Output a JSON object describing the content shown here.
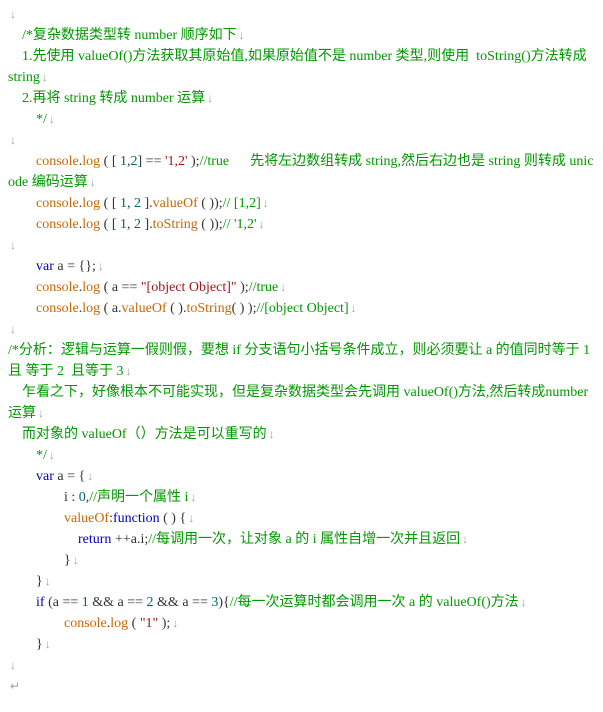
{
  "lines": [
    {
      "segments": [
        {
          "cls": "arrow",
          "t": "↓"
        }
      ]
    },
    {
      "indent": 1,
      "segments": [
        {
          "cls": "comment",
          "t": "/*复杂数据类型转 number 顺序如下"
        },
        {
          "cls": "arrow",
          "t": "↓"
        }
      ]
    },
    {
      "indent": 1,
      "segments": [
        {
          "cls": "comment",
          "t": "1.先使用 valueOf()方法获取其原始值,如果原始值不是 number 类型,则使用  toString()方法转成 string"
        },
        {
          "cls": "arrow",
          "t": "↓"
        }
      ]
    },
    {
      "indent": 1,
      "segments": [
        {
          "cls": "comment",
          "t": "2.再将 string 转成 number 运算"
        },
        {
          "cls": "arrow",
          "t": "↓"
        }
      ]
    },
    {
      "indent": 2,
      "segments": [
        {
          "cls": "comment",
          "t": "*/"
        },
        {
          "cls": "arrow",
          "t": "↓"
        }
      ]
    },
    {
      "segments": [
        {
          "cls": "arrow",
          "t": "↓"
        }
      ]
    },
    {
      "indent": 2,
      "segments": [
        {
          "cls": "method",
          "t": "console"
        },
        {
          "cls": "op",
          "t": "."
        },
        {
          "cls": "method",
          "t": "log"
        },
        {
          "cls": "op",
          "t": " ("
        },
        {
          "cls": "op",
          "t": " [ "
        },
        {
          "cls": "number",
          "t": "1"
        },
        {
          "cls": "op",
          "t": ","
        },
        {
          "cls": "number",
          "t": "2"
        },
        {
          "cls": "op",
          "t": "] "
        },
        {
          "cls": "op",
          "t": "=="
        },
        {
          "cls": "string",
          "t": " '1,2'"
        },
        {
          "cls": "op",
          "t": " );"
        },
        {
          "cls": "comment",
          "t": "//true      先将左边数组转成 string,然后右边也是 string 则转成 unicode 编码运算"
        },
        {
          "cls": "arrow",
          "t": "↓"
        }
      ]
    },
    {
      "indent": 2,
      "segments": [
        {
          "cls": "method",
          "t": "console"
        },
        {
          "cls": "op",
          "t": "."
        },
        {
          "cls": "method",
          "t": "log"
        },
        {
          "cls": "op",
          "t": " ("
        },
        {
          "cls": "op",
          "t": " [ "
        },
        {
          "cls": "number",
          "t": "1"
        },
        {
          "cls": "op",
          "t": ", "
        },
        {
          "cls": "number",
          "t": "2"
        },
        {
          "cls": "op",
          "t": " ]."
        },
        {
          "cls": "method",
          "t": "valueOf"
        },
        {
          "cls": "op",
          "t": " ( ));"
        },
        {
          "cls": "comment",
          "t": "// [1,2]"
        },
        {
          "cls": "arrow",
          "t": "↓"
        }
      ]
    },
    {
      "indent": 2,
      "segments": [
        {
          "cls": "method",
          "t": "console"
        },
        {
          "cls": "op",
          "t": "."
        },
        {
          "cls": "method",
          "t": "log"
        },
        {
          "cls": "op",
          "t": " ("
        },
        {
          "cls": "op",
          "t": " [ "
        },
        {
          "cls": "number",
          "t": "1"
        },
        {
          "cls": "op",
          "t": ", "
        },
        {
          "cls": "number",
          "t": "2"
        },
        {
          "cls": "op",
          "t": " ]."
        },
        {
          "cls": "method",
          "t": "toString"
        },
        {
          "cls": "op",
          "t": " ( ));"
        },
        {
          "cls": "comment",
          "t": "// '1,2'"
        },
        {
          "cls": "arrow",
          "t": "↓"
        }
      ]
    },
    {
      "segments": [
        {
          "cls": "arrow",
          "t": "↓"
        }
      ]
    },
    {
      "indent": 2,
      "segments": [
        {
          "cls": "keyword",
          "t": "var "
        },
        {
          "cls": "op",
          "t": "a "
        },
        {
          "cls": "op",
          "t": "= "
        },
        {
          "cls": "op",
          "t": "{};"
        },
        {
          "cls": "arrow",
          "t": "↓"
        }
      ]
    },
    {
      "indent": 2,
      "segments": [
        {
          "cls": "method",
          "t": "console"
        },
        {
          "cls": "op",
          "t": "."
        },
        {
          "cls": "method",
          "t": "log"
        },
        {
          "cls": "op",
          "t": " ("
        },
        {
          "cls": "op",
          "t": " a "
        },
        {
          "cls": "op",
          "t": "=="
        },
        {
          "cls": "string",
          "t": " \"[object Object]\""
        },
        {
          "cls": "op",
          "t": " );"
        },
        {
          "cls": "comment",
          "t": "//true"
        },
        {
          "cls": "arrow",
          "t": "↓"
        }
      ]
    },
    {
      "indent": 2,
      "segments": [
        {
          "cls": "method",
          "t": "console"
        },
        {
          "cls": "op",
          "t": "."
        },
        {
          "cls": "method",
          "t": "log"
        },
        {
          "cls": "op",
          "t": " ("
        },
        {
          "cls": "op",
          "t": " a."
        },
        {
          "cls": "method",
          "t": "valueOf"
        },
        {
          "cls": "op",
          "t": " ( )."
        },
        {
          "cls": "method",
          "t": "toString"
        },
        {
          "cls": "op",
          "t": "( ) );"
        },
        {
          "cls": "comment",
          "t": "//[object Object]"
        },
        {
          "cls": "arrow",
          "t": "↓"
        }
      ]
    },
    {
      "segments": [
        {
          "cls": "arrow",
          "t": "↓"
        }
      ]
    },
    {
      "segments": [
        {
          "cls": "comment",
          "t": "/*分析：逻辑与运算一假则假，要想 if 分支语句小括号条件成立，则必须要让 a 的值同时等于 1 且 等于 2  且等于 3"
        },
        {
          "cls": "arrow",
          "t": "↓"
        }
      ]
    },
    {
      "indent": 1,
      "segments": [
        {
          "cls": "comment",
          "t": "乍看之下，好像根本不可能实现，但是复杂数据类型会先调用 valueOf()方法,然后转成number 运算"
        },
        {
          "cls": "arrow",
          "t": "↓"
        }
      ]
    },
    {
      "indent": 1,
      "segments": [
        {
          "cls": "comment",
          "t": "而对象的 valueOf（）方法是可以重写的"
        },
        {
          "cls": "arrow",
          "t": "↓"
        }
      ]
    },
    {
      "indent": 2,
      "segments": [
        {
          "cls": "comment",
          "t": "*/"
        },
        {
          "cls": "arrow",
          "t": "↓"
        }
      ]
    },
    {
      "indent": 2,
      "segments": [
        {
          "cls": "keyword",
          "t": "var "
        },
        {
          "cls": "op",
          "t": "a "
        },
        {
          "cls": "op",
          "t": "= "
        },
        {
          "cls": "op",
          "t": "{"
        },
        {
          "cls": "arrow",
          "t": "↓"
        }
      ]
    },
    {
      "indent": 4,
      "segments": [
        {
          "cls": "op",
          "t": "i "
        },
        {
          "cls": "op",
          "t": ": "
        },
        {
          "cls": "number",
          "t": "0"
        },
        {
          "cls": "op",
          "t": ","
        },
        {
          "cls": "comment",
          "t": "//声明一个属性 i"
        },
        {
          "cls": "arrow",
          "t": "↓"
        }
      ]
    },
    {
      "indent": 4,
      "segments": [
        {
          "cls": "method",
          "t": "valueOf"
        },
        {
          "cls": "op",
          "t": ":"
        },
        {
          "cls": "keyword",
          "t": "function"
        },
        {
          "cls": "op",
          "t": " ( ) {"
        },
        {
          "cls": "arrow",
          "t": "↓"
        }
      ]
    },
    {
      "indent": 5,
      "segments": [
        {
          "cls": "keyword",
          "t": "return"
        },
        {
          "cls": "op",
          "t": " ++"
        },
        {
          "cls": "op",
          "t": "a.i;"
        },
        {
          "cls": "comment",
          "t": "//每调用一次，让对象 a 的 i 属性自增一次并且返回"
        },
        {
          "cls": "arrow",
          "t": "↓"
        }
      ]
    },
    {
      "indent": 4,
      "segments": [
        {
          "cls": "op",
          "t": "}"
        },
        {
          "cls": "arrow",
          "t": "↓"
        }
      ]
    },
    {
      "indent": 2,
      "segments": [
        {
          "cls": "op",
          "t": "}"
        },
        {
          "cls": "arrow",
          "t": "↓"
        }
      ]
    },
    {
      "indent": 2,
      "segments": [
        {
          "cls": "keyword",
          "t": "if "
        },
        {
          "cls": "op",
          "t": "(a "
        },
        {
          "cls": "op",
          "t": "== "
        },
        {
          "cls": "number",
          "t": "1"
        },
        {
          "cls": "op",
          "t": " && "
        },
        {
          "cls": "op",
          "t": "a "
        },
        {
          "cls": "op",
          "t": "== "
        },
        {
          "cls": "number",
          "t": "2"
        },
        {
          "cls": "op",
          "t": " && "
        },
        {
          "cls": "op",
          "t": "a "
        },
        {
          "cls": "op",
          "t": "== "
        },
        {
          "cls": "number",
          "t": "3"
        },
        {
          "cls": "op",
          "t": "){"
        },
        {
          "cls": "comment",
          "t": "//每一次运算时都会调用一次 a 的 valueOf()方法"
        },
        {
          "cls": "arrow",
          "t": "↓"
        }
      ]
    },
    {
      "indent": 4,
      "segments": [
        {
          "cls": "method",
          "t": "console"
        },
        {
          "cls": "op",
          "t": "."
        },
        {
          "cls": "method",
          "t": "log"
        },
        {
          "cls": "op",
          "t": " ("
        },
        {
          "cls": "string",
          "t": " \"1\""
        },
        {
          "cls": "op",
          "t": " );"
        },
        {
          "cls": "arrow",
          "t": "↓"
        }
      ]
    },
    {
      "indent": 2,
      "segments": [
        {
          "cls": "op",
          "t": "}"
        },
        {
          "cls": "arrow",
          "t": "↓"
        }
      ]
    },
    {
      "segments": [
        {
          "cls": "arrow",
          "t": "↓"
        }
      ]
    },
    {
      "segments": [
        {
          "cls": "arrow",
          "t": "↵"
        }
      ]
    }
  ]
}
